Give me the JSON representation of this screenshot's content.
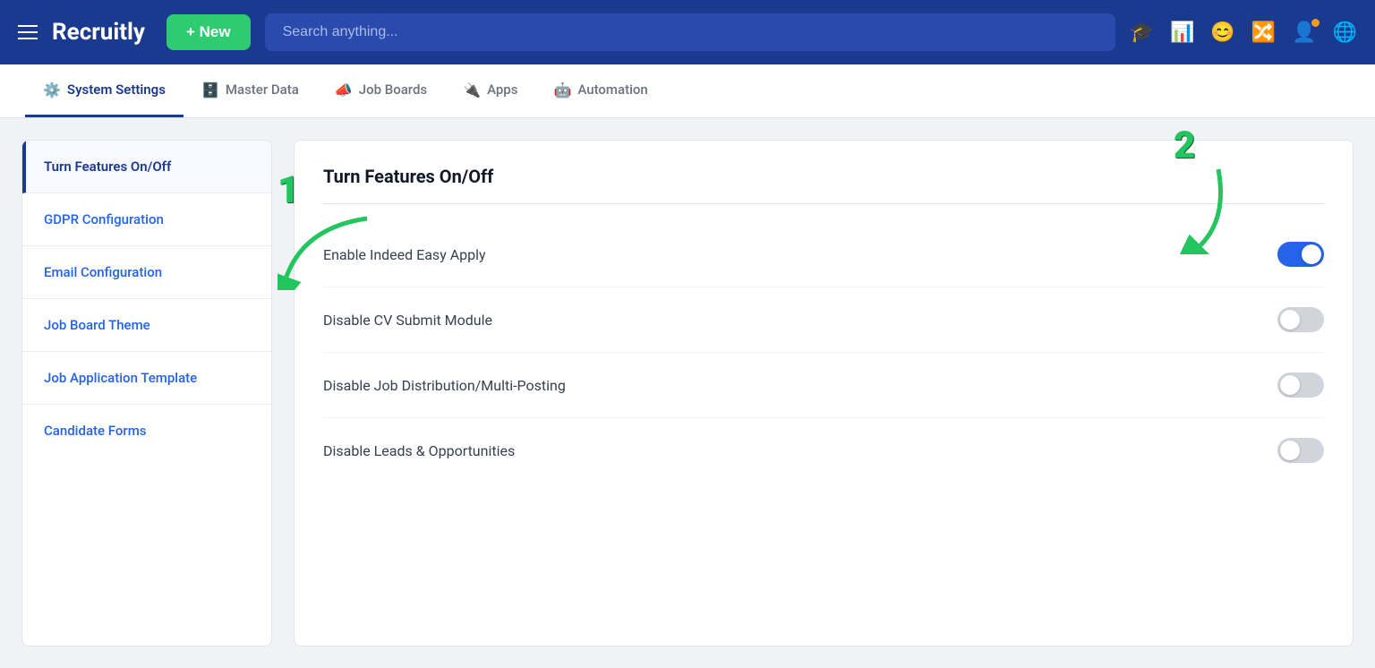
{
  "topnav": {
    "brand": "Recruitly",
    "new_btn": "+ New",
    "search_placeholder": "Search anything..."
  },
  "subnav": {
    "items": [
      {
        "id": "system-settings",
        "label": "System Settings",
        "icon": "⚙",
        "active": true
      },
      {
        "id": "master-data",
        "label": "Master Data",
        "icon": "🗄",
        "active": false
      },
      {
        "id": "job-boards",
        "label": "Job Boards",
        "icon": "📣",
        "active": false
      },
      {
        "id": "apps",
        "label": "Apps",
        "icon": "🔌",
        "active": false
      },
      {
        "id": "automation",
        "label": "Automation",
        "icon": "🤖",
        "active": false
      }
    ]
  },
  "sidebar": {
    "items": [
      {
        "id": "turn-features",
        "label": "Turn Features On/Off",
        "active": true
      },
      {
        "id": "gdpr",
        "label": "GDPR Configuration",
        "active": false
      },
      {
        "id": "email-config",
        "label": "Email Configuration",
        "active": false
      },
      {
        "id": "job-board-theme",
        "label": "Job Board Theme",
        "active": false
      },
      {
        "id": "job-app-template",
        "label": "Job Application Template",
        "active": false
      },
      {
        "id": "candidate-forms",
        "label": "Candidate Forms",
        "active": false
      }
    ]
  },
  "content": {
    "title": "Turn Features On/Off",
    "features": [
      {
        "id": "enable-indeed",
        "label": "Enable Indeed Easy Apply",
        "enabled": true
      },
      {
        "id": "disable-cv",
        "label": "Disable CV Submit Module",
        "enabled": false
      },
      {
        "id": "disable-job-dist",
        "label": "Disable Job Distribution/Multi-Posting",
        "enabled": false
      },
      {
        "id": "disable-leads",
        "label": "Disable Leads & Opportunities",
        "enabled": false
      }
    ]
  },
  "annotations": {
    "arrow1_label": "1",
    "arrow2_label": "2"
  }
}
